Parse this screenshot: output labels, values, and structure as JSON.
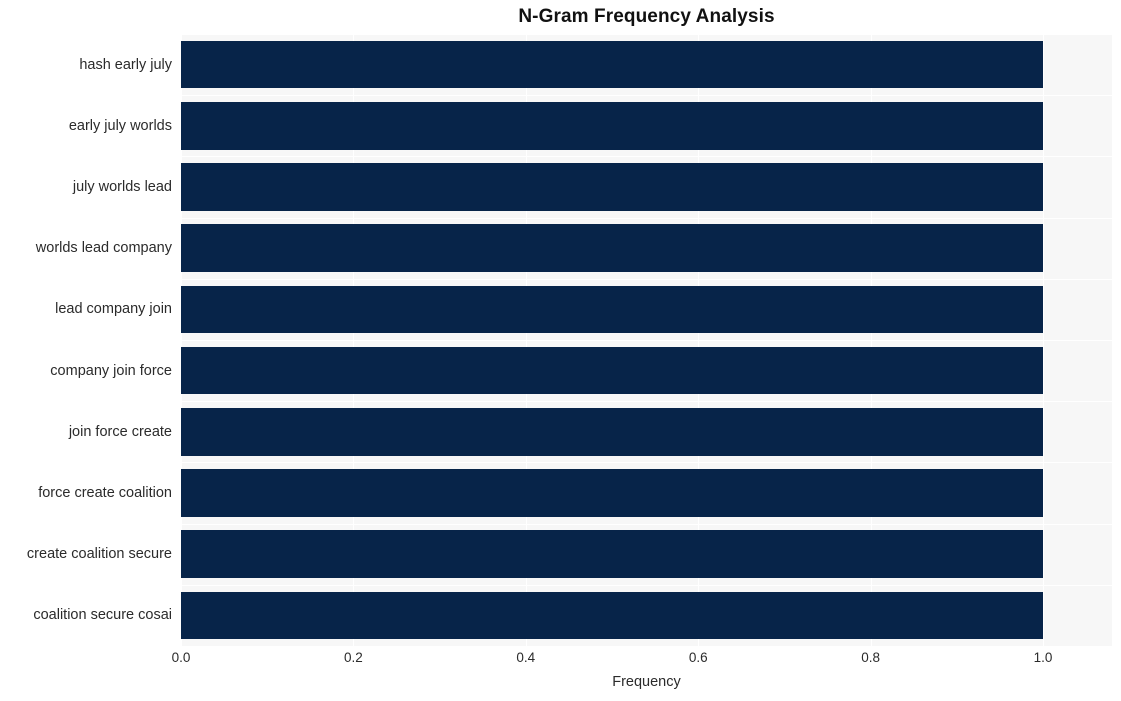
{
  "chart_data": {
    "type": "bar",
    "orientation": "horizontal",
    "title": "N-Gram Frequency Analysis",
    "xlabel": "Frequency",
    "ylabel": "",
    "categories": [
      "hash early july",
      "early july worlds",
      "july worlds lead",
      "worlds lead company",
      "lead company join",
      "company join force",
      "join force create",
      "force create coalition",
      "create coalition secure",
      "coalition secure cosai"
    ],
    "values": [
      1.0,
      1.0,
      1.0,
      1.0,
      1.0,
      1.0,
      1.0,
      1.0,
      1.0,
      1.0
    ],
    "xlim": [
      0.0,
      1.08
    ],
    "xticks": [
      0.0,
      0.2,
      0.4,
      0.6,
      0.8,
      1.0
    ],
    "xtick_labels": [
      "0.0",
      "0.2",
      "0.4",
      "0.6",
      "0.8",
      "1.0"
    ],
    "grid": true,
    "legend": null,
    "bar_color": "#072449",
    "plot_background": "#f7f7f7",
    "figure_background": "#ffffff",
    "gridline_color": "#ffffff",
    "text_color": "#2b2b2b",
    "title_color": "#111111"
  }
}
